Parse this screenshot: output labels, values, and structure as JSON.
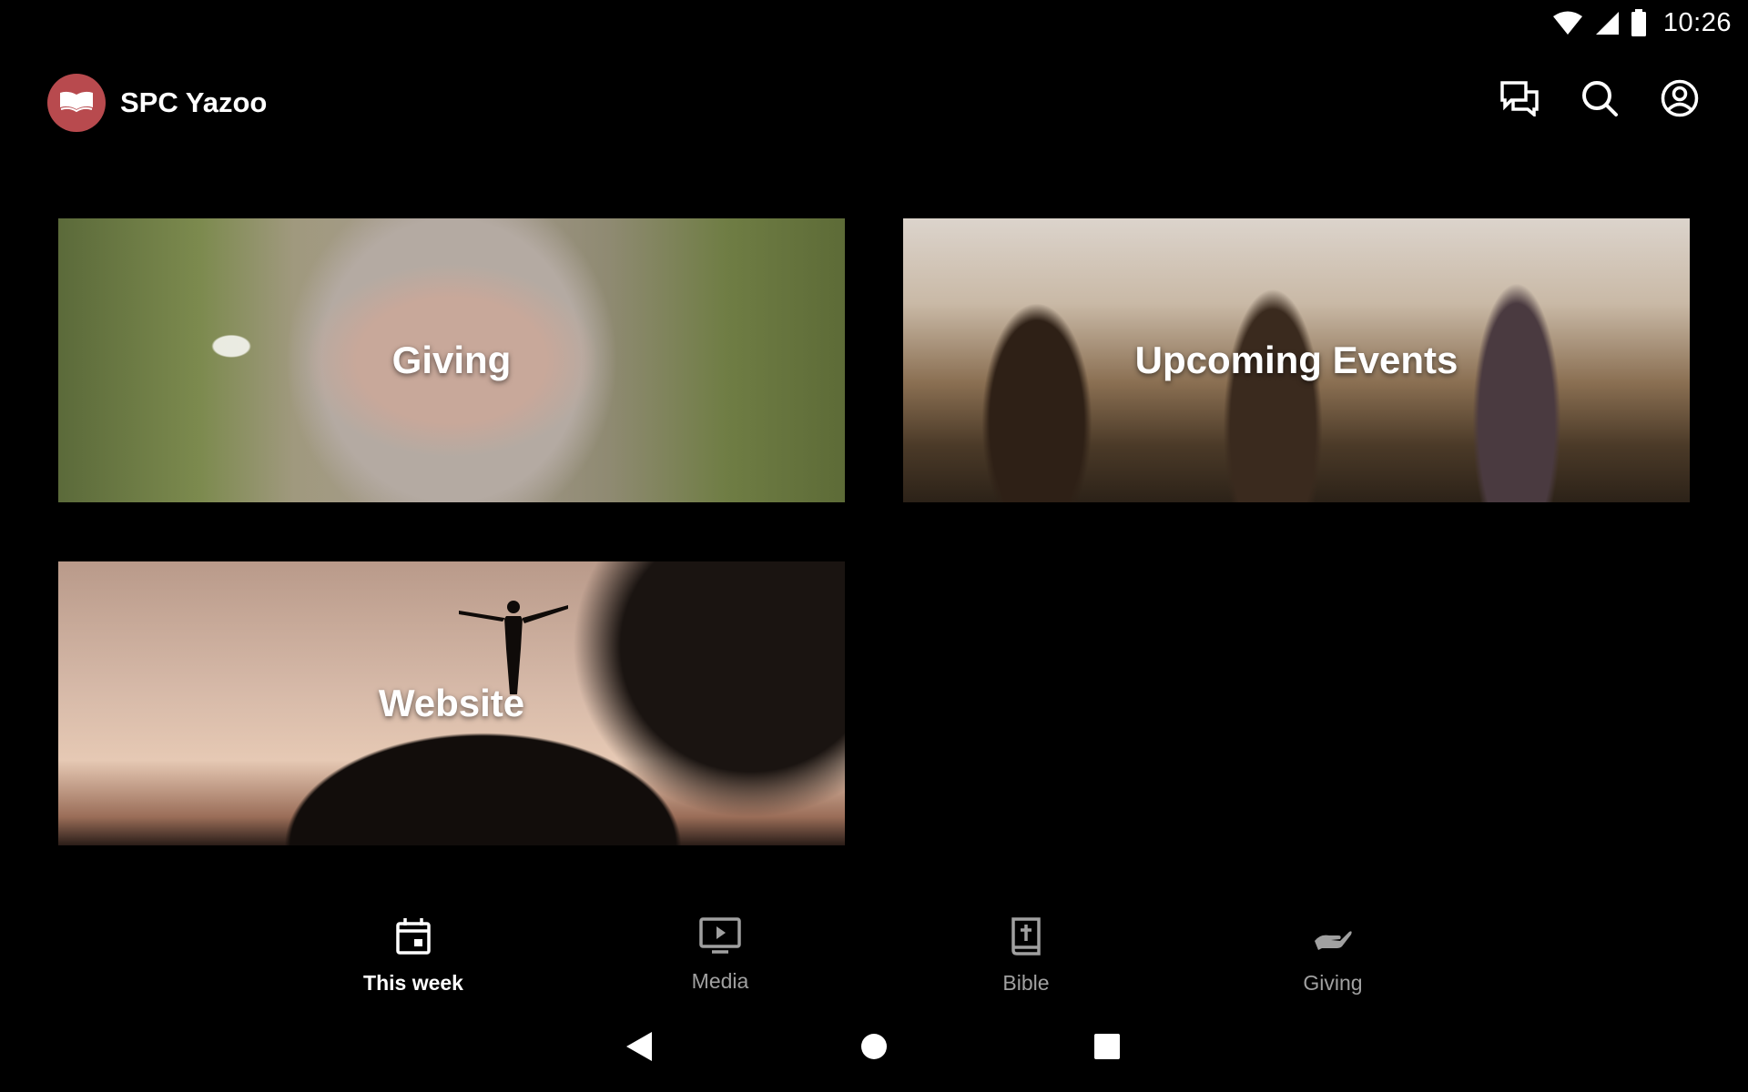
{
  "status_bar": {
    "time": "10:26"
  },
  "app_bar": {
    "title": "SPC Yazoo",
    "actions": [
      "chat-icon",
      "search-icon",
      "account-icon"
    ]
  },
  "cards": [
    {
      "label": "Giving"
    },
    {
      "label": "Upcoming Events"
    },
    {
      "label": "Website"
    }
  ],
  "bottom_nav": {
    "items": [
      {
        "label": "This week",
        "icon": "calendar-icon",
        "active": true
      },
      {
        "label": "Media",
        "icon": "media-player-icon",
        "active": false
      },
      {
        "label": "Bible",
        "icon": "bible-icon",
        "active": false
      },
      {
        "label": "Giving",
        "icon": "giving-hand-icon",
        "active": false
      }
    ]
  },
  "colors": {
    "background": "#000000",
    "logo": "#b84a4e",
    "nav_inactive": "#a0a0a0",
    "nav_active": "#ffffff"
  }
}
